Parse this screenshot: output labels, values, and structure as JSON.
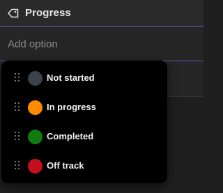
{
  "header": {
    "title": "Progress",
    "icon": "tag-icon"
  },
  "add_option": {
    "placeholder": "Add option"
  },
  "menu": {
    "items": [
      {
        "label": "Not started",
        "color": "#3b4249",
        "icon": "grip-icon"
      },
      {
        "label": "In progress",
        "color": "#ff8c00",
        "icon": "grip-icon"
      },
      {
        "label": "Completed",
        "color": "#107c10",
        "icon": "grip-icon"
      },
      {
        "label": "Off track",
        "color": "#c50f1f",
        "icon": "grip-icon"
      }
    ]
  },
  "colors": {
    "accent_border": "#6b63c7",
    "background": "#1f1f1f",
    "menu_background": "#000000"
  }
}
